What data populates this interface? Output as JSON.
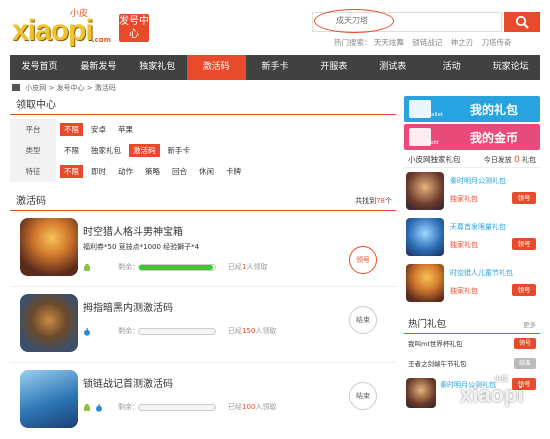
{
  "header": {
    "logo_text": "xiaopi",
    "logo_small": "小皮",
    "logo_com": ".com",
    "logo_tag": "发号中心",
    "search_placeholder": "成天刀塔",
    "hot_label": "热门搜索：",
    "hot_items": [
      "天天炫舞",
      "锁链战记",
      "神之刃",
      "刀塔传奇"
    ]
  },
  "nav": {
    "items": [
      "发号首页",
      "最新发号",
      "独家礼包",
      "激活码",
      "新手卡",
      "开服表",
      "测试表",
      "活动",
      "玩家论坛"
    ],
    "active_index": 3
  },
  "breadcrumb": [
    "小皮网",
    "发号中心",
    "激活码"
  ],
  "filter": {
    "title": "领取中心",
    "rows": [
      {
        "label": "平台",
        "options": [
          "不限",
          "安卓",
          "苹果"
        ],
        "selected": 0
      },
      {
        "label": "类型",
        "options": [
          "不限",
          "独家礼包",
          "激活码",
          "新手卡"
        ],
        "selected": 2
      },
      {
        "label": "特征",
        "options": [
          "不限",
          "即时",
          "动作",
          "策略",
          "回合",
          "休闲",
          "卡牌"
        ],
        "selected": 0
      }
    ]
  },
  "codes": {
    "title": "激活码",
    "found_prefix": "共找到",
    "found_count": "78",
    "found_suffix": "个",
    "items": [
      {
        "title": "时空猎人格斗男神宝箱",
        "desc": "福利券*50 竞技点*1000 经验獅子*4",
        "remain_label": "剩余：",
        "progress": 0.97,
        "claimed_prefix": "已经",
        "claimed_count": "1",
        "claimed_suffix": "人领取",
        "button": "领号",
        "platforms": [
          "android"
        ],
        "button_color": "#e84b2b"
      },
      {
        "title": "拇指暗黑内测激活码",
        "desc": "",
        "remain_label": "剩余：",
        "progress": 0.0,
        "claimed_prefix": "已经",
        "claimed_count": "150",
        "claimed_suffix": "人领取",
        "button": "结束",
        "platforms": [
          "ios"
        ],
        "button_color": "#cccccc"
      },
      {
        "title": "锁链战记首测激活码",
        "desc": "",
        "remain_label": "剩余：",
        "progress": 0.0,
        "claimed_prefix": "已经",
        "claimed_count": "100",
        "claimed_suffix": "人领取",
        "button": "结束",
        "platforms": [
          "android",
          "ios"
        ],
        "button_color": "#cccccc"
      }
    ]
  },
  "sidebar": {
    "my_gift_small": "Wallet",
    "my_gift": "我的礼包",
    "my_coin_small": "Gold",
    "my_coin": "我的金币",
    "packs_title": "小皮网独家礼包",
    "today_prefix": "今日发放",
    "today_count": "0",
    "today_suffix": "礼包",
    "packs": [
      {
        "name": "秦时明月公测礼包",
        "tag": "独家礼包",
        "button": "领号"
      },
      {
        "name": "天尊首发限量礼包",
        "tag": "独家礼包",
        "button": "领号"
      },
      {
        "name": "时空猎人儿童节礼包",
        "tag": "独家礼包",
        "button": "领号"
      }
    ],
    "hot_title": "热门礼包",
    "hot_more": "更多",
    "hot_rows": [
      {
        "name": "我叫mt世界杯礼包",
        "button": "领号",
        "color": "#e84b2b"
      },
      {
        "name": "王者之剑端午节礼包",
        "button": "结束",
        "color": "#bbbbbb"
      }
    ],
    "hot_pack": {
      "name": "秦时明月公测礼包",
      "button": "领号"
    }
  },
  "watermark": {
    "text": "xiaopi",
    "small": "小皮"
  },
  "colors": {
    "accent": "#e84b2b",
    "nav_bg": "#414141",
    "blue": "#27a3e0",
    "pink": "#e84b7a"
  }
}
